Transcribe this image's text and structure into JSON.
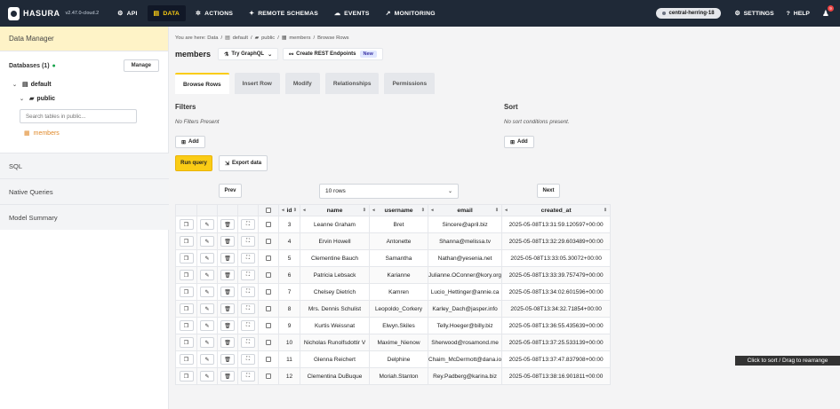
{
  "topbar": {
    "logo": "HASURA",
    "version": "v2.47.0-cloud.2",
    "nav": [
      {
        "label": "API",
        "icon": "api-icon"
      },
      {
        "label": "DATA",
        "icon": "database-icon",
        "active": true
      },
      {
        "label": "ACTIONS",
        "icon": "actions-icon"
      },
      {
        "label": "REMOTE SCHEMAS",
        "icon": "remote-schema-icon"
      },
      {
        "label": "EVENTS",
        "icon": "cloud-icon"
      },
      {
        "label": "MONITORING",
        "icon": "chart-icon"
      }
    ],
    "project": "central-herring-18",
    "settings": "SETTINGS",
    "help": "HELP",
    "notifications": "9"
  },
  "sidebar": {
    "header": "Data Manager",
    "databases_label": "Databases (1)",
    "manage": "Manage",
    "default_db": "default",
    "schema": "public",
    "search_placeholder": "Search tables in public...",
    "table": "members",
    "sections": [
      "SQL",
      "Native Queries",
      "Model Summary"
    ]
  },
  "breadcrumb": {
    "prefix": "You are here: Data",
    "items": [
      "default",
      "public",
      "members",
      "Browse Rows"
    ]
  },
  "header": {
    "title": "members",
    "try_graphql": "Try GraphQL",
    "create_rest": "Create REST Endpoints",
    "new_badge": "New"
  },
  "tabs": [
    "Browse Rows",
    "Insert Row",
    "Modify",
    "Relationships",
    "Permissions"
  ],
  "filters": {
    "title": "Filters",
    "empty": "No Filters Present",
    "add": "Add"
  },
  "sort": {
    "title": "Sort",
    "empty": "No sort conditions present.",
    "add": "Add"
  },
  "run_query": "Run query",
  "export_data": "Export data",
  "pager": {
    "prev": "Prev",
    "rows": "10 rows",
    "next": "Next"
  },
  "table": {
    "columns": [
      "id",
      "name",
      "username",
      "email",
      "created_at"
    ],
    "rows": [
      [
        "3",
        "Leanne Graham",
        "Bret",
        "Sincere@april.biz",
        "2025-05-08T13:31:59.120597+00:00"
      ],
      [
        "4",
        "Ervin Howell",
        "Antonette",
        "Shanna@melissa.tv",
        "2025-05-08T13:32:29.603489+00:00"
      ],
      [
        "5",
        "Clementine Bauch",
        "Samantha",
        "Nathan@yesenia.net",
        "2025-05-08T13:33:05.30072+00:00"
      ],
      [
        "6",
        "Patricia Lebsack",
        "Karianne",
        "Julianne.OConner@kory.org",
        "2025-05-08T13:33:39.757479+00:00"
      ],
      [
        "7",
        "Chelsey Dietrich",
        "Kamren",
        "Lucio_Hettinger@annie.ca",
        "2025-05-08T13:34:02.601596+00:00"
      ],
      [
        "8",
        "Mrs. Dennis Schulist",
        "Leopoldo_Corkery",
        "Karley_Dach@jasper.info",
        "2025-05-08T13:34:32.71854+00:00"
      ],
      [
        "9",
        "Kurtis Weissnat",
        "Elwyn.Skiles",
        "Telly.Hoeger@billy.biz",
        "2025-05-08T13:36:55.435639+00:00"
      ],
      [
        "10",
        "Nicholas Runolfsdottir V",
        "Maxime_Nienow",
        "Sherwood@rosamond.me",
        "2025-05-08T13:37:25.533139+00:00"
      ],
      [
        "11",
        "Glenna Reichert",
        "Delphine",
        "Chaim_McDermott@dana.io",
        "2025-05-08T13:37:47.837908+00:00"
      ],
      [
        "12",
        "Clementina DuBuque",
        "Moriah.Stanton",
        "Rey.Padberg@karina.biz",
        "2025-05-08T13:38:16.901811+00:00"
      ]
    ]
  },
  "tooltip": "Click to sort / Drag to rearrange"
}
